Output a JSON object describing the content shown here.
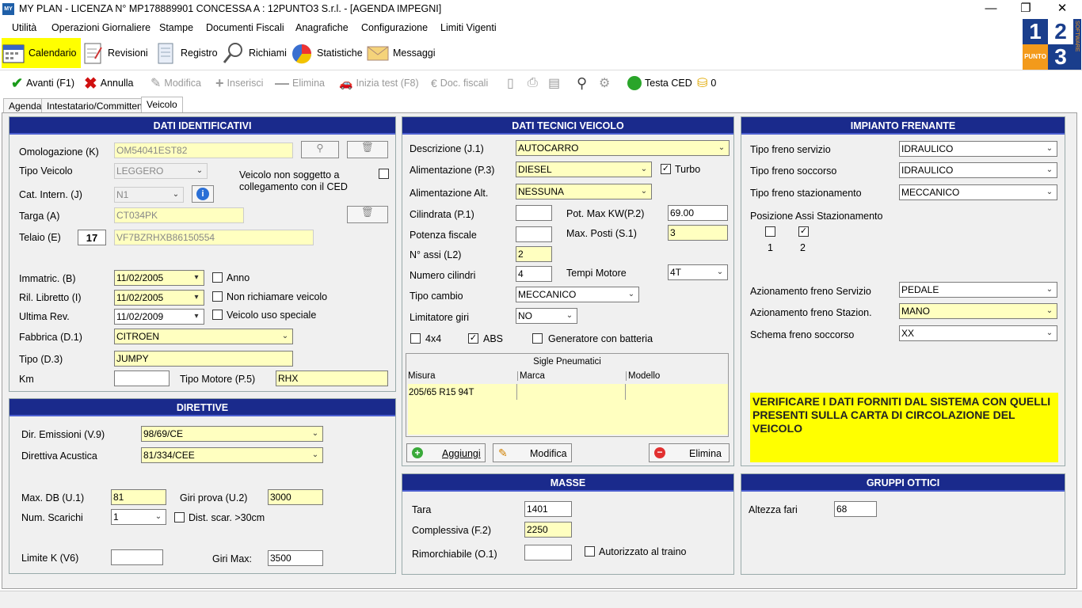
{
  "window": {
    "title": "MY PLAN - LICENZA N° MP178889901 CONCESSA A : 12PUNTO3 S.r.l. - [AGENDA IMPEGNI]",
    "icon_text": "MY",
    "minimize": "—",
    "maximize": "❐",
    "close": "✕"
  },
  "menu": [
    "Utilità",
    "Operazioni Giornaliere",
    "Stampe",
    "Documenti Fiscali",
    "Anagrafiche",
    "Configurazione",
    "Limiti Vigenti"
  ],
  "ribbon": [
    {
      "label": "Calendario",
      "icon": "calendar-icon"
    },
    {
      "label": "Revisioni",
      "icon": "checklist-icon"
    },
    {
      "label": "Registro",
      "icon": "register-icon"
    },
    {
      "label": "Richiami",
      "icon": "magnifier-icon"
    },
    {
      "label": "Statistiche",
      "icon": "pie-chart-icon"
    },
    {
      "label": "Messaggi",
      "icon": "envelope-icon"
    }
  ],
  "logo": {
    "d1": "1",
    "d2": "2",
    "d3": "3",
    "punto": "PUNTO",
    "software": "SOFTWARE"
  },
  "toolbar": {
    "avanti": "Avanti (F1)",
    "annulla": "Annulla",
    "modifica": "Modifica",
    "inserisci": "Inserisci",
    "elimina": "Elimina",
    "inizia_test": "Inizia test (F8)",
    "doc_fiscali": "Doc. fiscali",
    "testa_ced": "Testa CED",
    "coins": "0"
  },
  "tabs": [
    "Agenda",
    "Intestatario/Committente",
    "Veicolo"
  ],
  "ident": {
    "header": "DATI IDENTIFICATIVI",
    "omologazione_label": "Omologazione (K)",
    "omologazione": "OM54041EST82",
    "tipo_veicolo_label": "Tipo Veicolo",
    "tipo_veicolo": "LEGGERO",
    "non_soggetto_1": "Veicolo non soggetto a",
    "non_soggetto_2": "collegamento con il CED",
    "cat_label": "Cat. Intern. (J)",
    "cat": "N1",
    "targa_label": "Targa (A)",
    "targa": "CT034PK",
    "telaio_label": "Telaio (E)",
    "telaio_count": "17",
    "telaio": "VF7BZRHXB86150554",
    "immatric_label": "Immatric. (B)",
    "immatric": "11/02/2005",
    "anno": "Anno",
    "ril_label": "Ril. Libretto (I)",
    "ril": "11/02/2005",
    "non_richiamare": "Non richiamare veicolo",
    "ultima_label": "Ultima Rev.",
    "ultima": "11/02/2009",
    "uso_speciale": "Veicolo uso speciale",
    "fabbrica_label": "Fabbrica (D.1)",
    "fabbrica": "CITROEN",
    "tipo_label": "Tipo (D.3)",
    "tipo": "JUMPY",
    "km_label": "Km",
    "km": "",
    "tipo_motore_label": "Tipo Motore (P.5)",
    "tipo_motore": "RHX"
  },
  "direttive": {
    "header": "DIRETTIVE",
    "emissioni_label": "Dir. Emissioni (V.9)",
    "emissioni": "98/69/CE",
    "acustica_label": "Direttiva Acustica",
    "acustica": "81/334/CEE",
    "maxdb_label": "Max. DB (U.1)",
    "maxdb": "81",
    "giri_prova_label": "Giri prova (U.2)",
    "giri_prova": "3000",
    "scarichi_label": "Num. Scarichi",
    "scarichi": "1",
    "dist_scar": "Dist. scar. >30cm",
    "limitek_label": "Limite K (V6)",
    "limitek": "",
    "girimax_label": "Giri Max:",
    "girimax": "3500"
  },
  "tecnici": {
    "header": "DATI TECNICI VEICOLO",
    "descrizione_label": "Descrizione (J.1)",
    "descrizione": "AUTOCARRO",
    "alim_label": "Alimentazione (P.3)",
    "alim": "DIESEL",
    "turbo": "Turbo",
    "alim_alt_label": "Alimentazione Alt.",
    "alim_alt": "NESSUNA",
    "cilindrata_label": "Cilindrata (P.1)",
    "cilindrata": "",
    "potmax_label": "Pot. Max  KW(P.2)",
    "potmax": "69.00",
    "potfisc_label": "Potenza fiscale",
    "potfisc": "",
    "maxposti_label": "Max. Posti (S.1)",
    "maxposti": "3",
    "assi_label": "N° assi (L2)",
    "assi": "2",
    "cilindri_label": "Numero cilindri",
    "cilindri": "4",
    "tempi_label": "Tempi Motore",
    "tempi": "4T",
    "cambio_label": "Tipo cambio",
    "cambio": "MECCANICO",
    "limitatore_label": "Limitatore giri",
    "limitatore": "NO",
    "c4x4": "4x4",
    "abs": "ABS",
    "generatore": "Generatore con batteria",
    "sigle_title": "Sigle Pneumatici",
    "col_misura": "Misura",
    "col_marca": "Marca",
    "col_modello": "Modello",
    "pneumatico": "205/65 R15 94T",
    "aggiungi": "Aggiungi",
    "modifica": "Modifica",
    "elimina": "Elimina"
  },
  "masse": {
    "header": "MASSE",
    "tara_label": "Tara",
    "tara": "1401",
    "compl_label": "Complessiva (F.2)",
    "compl": "2250",
    "rimorch_label": "Rimorchiabile (O.1)",
    "rimorch": "",
    "autorizzato": "Autorizzato al traino"
  },
  "freni": {
    "header": "IMPIANTO FRENANTE",
    "servizio_label": "Tipo freno servizio",
    "servizio": "IDRAULICO",
    "soccorso_label": "Tipo freno soccorso",
    "soccorso": "IDRAULICO",
    "stazion_label": "Tipo freno stazionamento",
    "stazion": "MECCANICO",
    "pos_label": "Posizione Assi Stazionamento",
    "asse1": "1",
    "asse2": "2",
    "az_serv_label": "Azionamento freno Servizio",
    "az_serv": "PEDALE",
    "az_staz_label": "Azionamento freno Stazion.",
    "az_staz": "MANO",
    "schema_label": "Schema freno soccorso",
    "schema": "XX",
    "avviso": "VERIFICARE I DATI FORNITI DAL SISTEMA CON QUELLI PRESENTI SULLA CARTA DI CIRCOLAZIONE DEL VEICOLO"
  },
  "ottici": {
    "header": "GRUPPI OTTICI",
    "fari_label": "Altezza fari",
    "fari": "68"
  }
}
